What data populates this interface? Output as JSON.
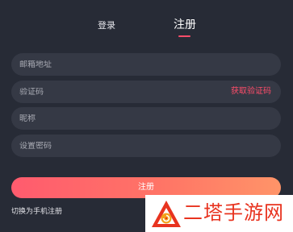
{
  "tabs": {
    "login": "登录",
    "register": "注册"
  },
  "form": {
    "email_placeholder": "邮箱地址",
    "code_placeholder": "验证码",
    "get_code": "获取验证码",
    "nickname_placeholder": "昵称",
    "password_placeholder": "设置密码",
    "submit": "注册"
  },
  "switch_link": "切换为手机注册",
  "watermark": {
    "text": "二塔手游网",
    "logo": "swirl-triangle-icon"
  },
  "colors": {
    "accent": "#ff4d6a",
    "background": "#272b36",
    "field": "#353945",
    "watermark": "#e8331f"
  }
}
